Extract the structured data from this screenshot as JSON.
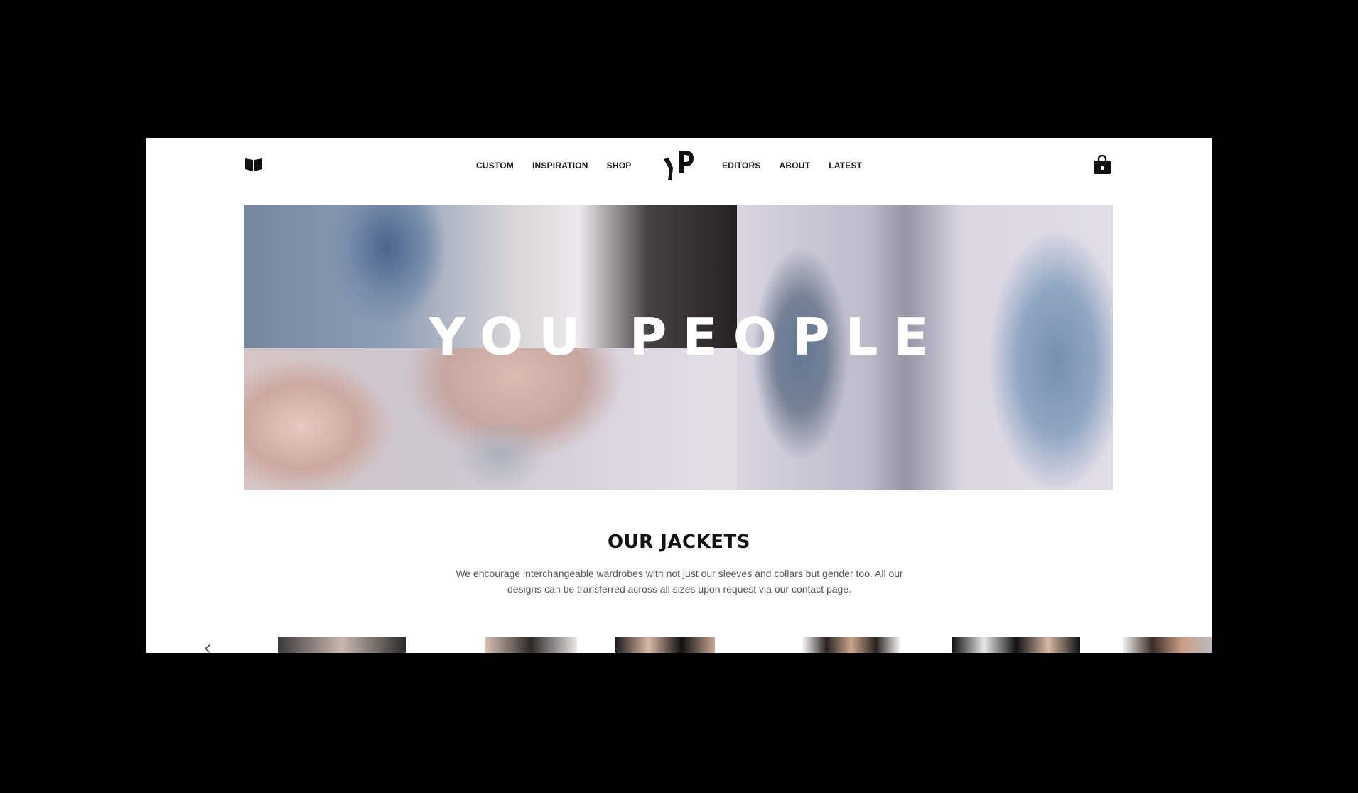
{
  "header": {
    "nav_left": [
      "CUSTOM",
      "INSPIRATION",
      "SHOP"
    ],
    "nav_right": [
      "EDITORS",
      "ABOUT",
      "LATEST"
    ],
    "logo_text": "YP",
    "icons": {
      "left": "book-icon",
      "right": "shopping-bag-icon"
    }
  },
  "hero": {
    "title": "YOU PEOPLE"
  },
  "section": {
    "title": "OUR JACKETS",
    "description": "We encourage interchangeable wardrobes with not just our sleeves and collars but gender too. All our designs can be transferred across all sizes upon request via our contact page."
  },
  "colors": {
    "frame": "#000000",
    "page": "#ffffff",
    "text": "#1b1b1b",
    "muted": "#555555"
  }
}
